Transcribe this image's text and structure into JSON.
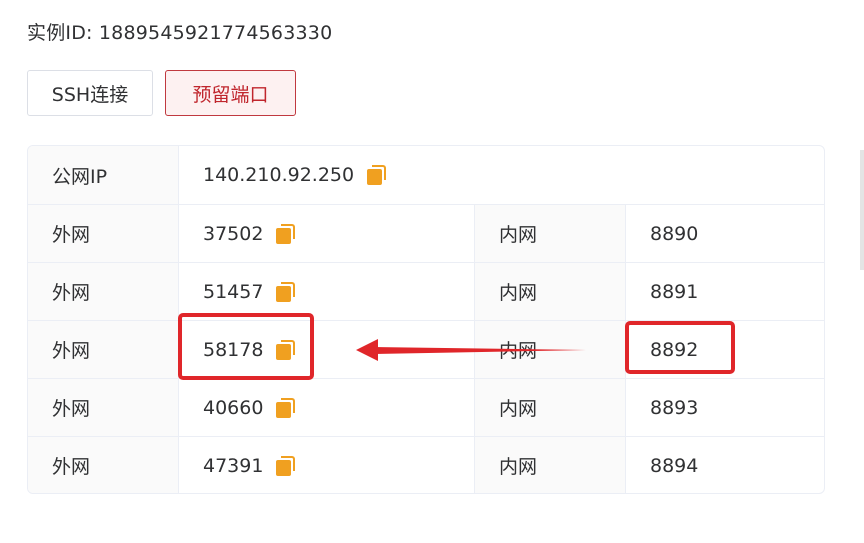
{
  "instance": {
    "label": "实例ID: 1889545921774563330"
  },
  "buttons": {
    "ssh": "SSH连接",
    "reserved_ports": "预留端口"
  },
  "public_ip": {
    "label": "公网IP",
    "value": "140.210.92.250"
  },
  "ports": [
    {
      "ext_label": "外网",
      "ext": "37502",
      "int_label": "内网",
      "int": "8890"
    },
    {
      "ext_label": "外网",
      "ext": "51457",
      "int_label": "内网",
      "int": "8891"
    },
    {
      "ext_label": "外网",
      "ext": "58178",
      "int_label": "内网",
      "int": "8892"
    },
    {
      "ext_label": "外网",
      "ext": "40660",
      "int_label": "内网",
      "int": "8893"
    },
    {
      "ext_label": "外网",
      "ext": "47391",
      "int_label": "内网",
      "int": "8894"
    }
  ],
  "colors": {
    "accent": "#c0262d",
    "copy_icon": "#f0a020",
    "annotation": "#e0262a",
    "border": "#ebeef5"
  },
  "annotation": {
    "highlighted_external": "58178",
    "highlighted_internal": "8892"
  }
}
